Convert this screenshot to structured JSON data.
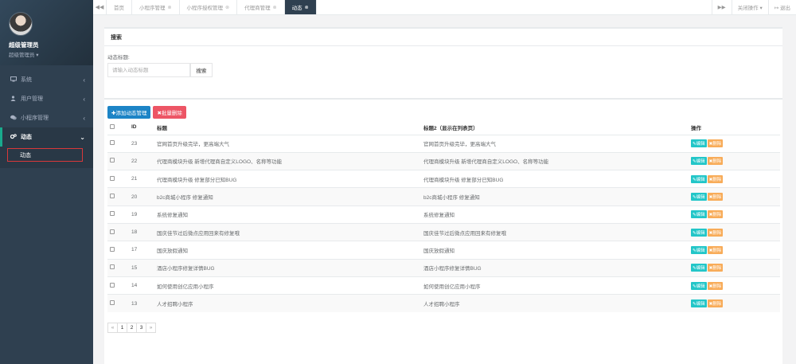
{
  "profile": {
    "name": "超级管理员",
    "role": "超级管理员 ▾"
  },
  "sidebar": {
    "items": [
      {
        "label": "系统",
        "icon": "monitor-icon",
        "chev": "‹"
      },
      {
        "label": "用户管理",
        "icon": "user-icon",
        "chev": "‹"
      },
      {
        "label": "小程序管理",
        "icon": "chat-icon",
        "chev": "‹"
      },
      {
        "label": "动态",
        "icon": "gears-icon",
        "chev": "⌄"
      }
    ],
    "sub_item": "动态"
  },
  "tabs": {
    "back": "◀◀",
    "items": [
      {
        "label": "首页",
        "close": ""
      },
      {
        "label": "小程序管理",
        "close": "⊗"
      },
      {
        "label": "小程序授权管理",
        "close": "⊗"
      },
      {
        "label": "代理商管理",
        "close": "⊗"
      },
      {
        "label": "动态",
        "close": "⊗"
      }
    ],
    "forward": "▶▶",
    "close_ops": "关闭操作 ▾",
    "logout": "↦ 退出"
  },
  "search": {
    "title": "搜索",
    "label": "动态标题:",
    "placeholder": "请输入动态标题",
    "button": "搜索"
  },
  "actions": {
    "add": "✚添加动态管理",
    "batch_delete": "✖批量删除"
  },
  "table": {
    "headers": {
      "id": "ID",
      "title": "标题",
      "title2": "标题2（显示在列表页）",
      "ops": "操作"
    },
    "edit_label": "✎编辑",
    "delete_label": "✖删除",
    "rows": [
      {
        "id": "23",
        "title": "官网首页升级完毕，更高端大气",
        "title2": "官网首页升级完毕，更高端大气"
      },
      {
        "id": "22",
        "title": "代理商模块升级 新增代理商自定义LOGO、名称等功能",
        "title2": "代理商模块升级 新增代理商自定义LOGO、名称等功能"
      },
      {
        "id": "21",
        "title": "代理商模块升级 修复部分已知BUG",
        "title2": "代理商模块升级 修复部分已知BUG"
      },
      {
        "id": "20",
        "title": "b2c商城小程序 修复通知",
        "title2": "b2c商城小程序 修复通知"
      },
      {
        "id": "19",
        "title": "系统修复通知",
        "title2": "系统修复通知"
      },
      {
        "id": "18",
        "title": "国庆佳节过后微点应用回来有修复哦",
        "title2": "国庆佳节过后微点应用回来有修复哦"
      },
      {
        "id": "17",
        "title": "国庆放假通知",
        "title2": "国庆放假通知"
      },
      {
        "id": "15",
        "title": "酒店小程序修复详情BUG",
        "title2": "酒店小程序修复详情BUG"
      },
      {
        "id": "14",
        "title": "如何使用创亿应用小程序",
        "title2": "如何使用创亿应用小程序"
      },
      {
        "id": "13",
        "title": "人才招聘小程序",
        "title2": "人才招聘小程序"
      }
    ]
  },
  "pagination": {
    "prev": "«",
    "pages": [
      "1",
      "2",
      "3"
    ],
    "next": "»"
  }
}
